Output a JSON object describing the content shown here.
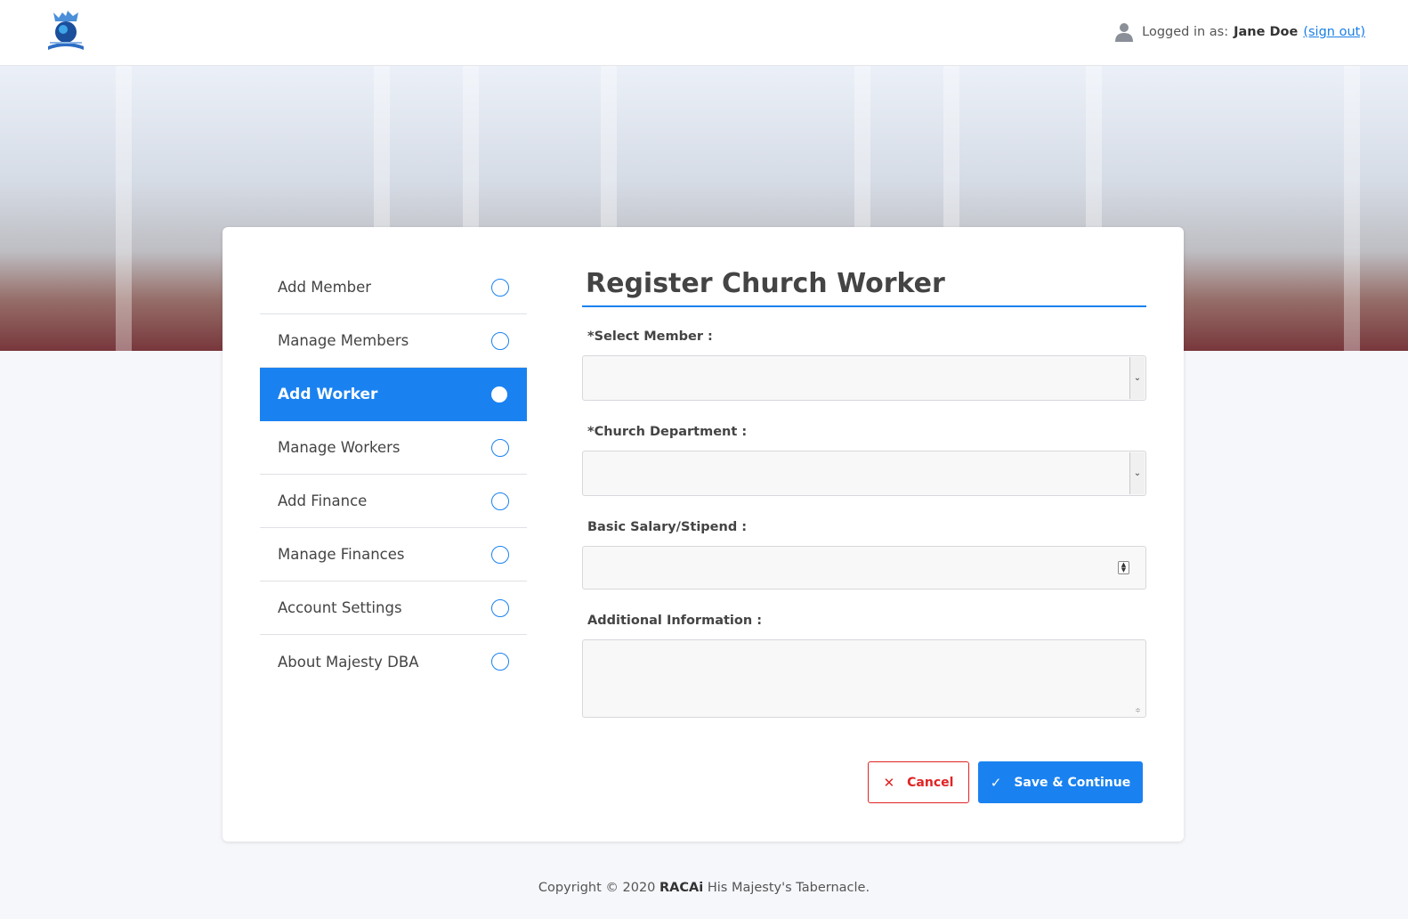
{
  "header": {
    "logged_in_prefix": "Logged in as:",
    "user_name": "Jane Doe",
    "sign_out_label": "(sign out)"
  },
  "sidebar": {
    "items": [
      {
        "label": "Add Member",
        "active": false
      },
      {
        "label": "Manage Members",
        "active": false
      },
      {
        "label": "Add Worker",
        "active": true
      },
      {
        "label": "Manage Workers",
        "active": false
      },
      {
        "label": "Add Finance",
        "active": false
      },
      {
        "label": "Manage Finances",
        "active": false
      },
      {
        "label": "Account Settings",
        "active": false
      },
      {
        "label": "About Majesty DBA",
        "active": false
      }
    ]
  },
  "form": {
    "title": "Register Church Worker",
    "select_member_label": "*Select Member :",
    "select_member_value": "",
    "department_label": "*Church Department :",
    "department_value": "",
    "salary_label": "Basic Salary/Stipend :",
    "salary_value": "",
    "additional_label": "Additional Information :",
    "additional_value": "",
    "cancel_label": "Cancel",
    "save_label": "Save & Continue"
  },
  "footer": {
    "prefix": "Copyright © 2020",
    "brand": "RACAi",
    "suffix": "His Majesty's Tabernacle."
  },
  "colors": {
    "accent": "#1a82f0",
    "danger": "#e02424",
    "background": "#f6f7fb"
  },
  "icons": {
    "logo": "church-logo-icon",
    "user": "user-icon",
    "nav_marker": "circle-icon",
    "select_arrow": "chevron-down-icon",
    "number_spinner": "spinner-icon",
    "cancel": "close-icon",
    "save": "check-icon"
  }
}
